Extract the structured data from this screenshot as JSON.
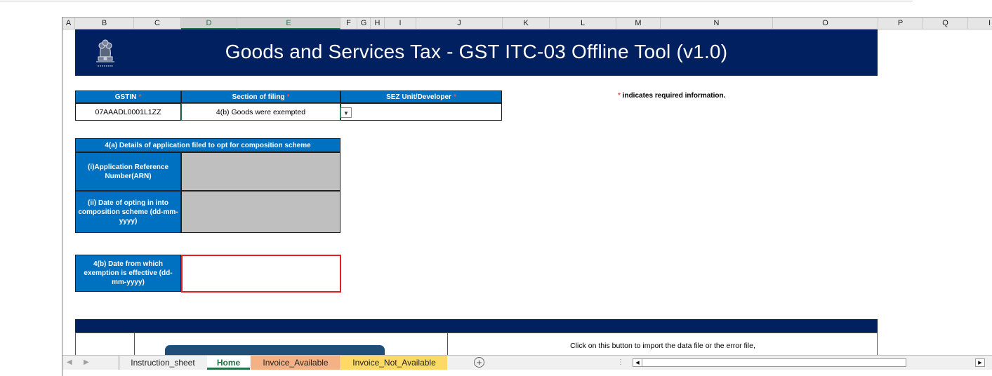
{
  "columns": [
    "A",
    "B",
    "C",
    "D",
    "E",
    "F",
    "G",
    "H",
    "I",
    "J",
    "K",
    "L",
    "M",
    "N",
    "O",
    "P",
    "Q",
    "I"
  ],
  "banner": {
    "title": "Goods and Services Tax - GST ITC-03 Offline Tool (v1.0)",
    "emblem_icon": "ashoka-emblem-icon"
  },
  "form": {
    "gstin_header": "GSTIN",
    "section_header": "Section of filing",
    "sez_header": "SEZ Unit/Developer",
    "gstin_value": "07AAADL0001L1ZZ",
    "section_value": "4(b) Goods were exempted",
    "sez_value": ""
  },
  "required_note": {
    "star": "*",
    "text": " indicates required information."
  },
  "section_4a": {
    "header": "4(a) Details of application filed to opt for composition scheme",
    "arn_label": "(i)Application Reference Number(ARN)",
    "date_label": "(ii) Date of opting in into composition scheme (dd-mm-yyyy)"
  },
  "section_4b": {
    "label": "4(b) Date from which exemption is effective (dd-mm-yyyy)"
  },
  "bottom": {
    "click_note": "Click on this button to import the data file or the error file,"
  },
  "sheet_tabs": [
    "Instruction_sheet",
    "Home",
    "Invoice_Available",
    "Invoice_Not_Available"
  ],
  "colors": {
    "banner": "#002060",
    "header_blue": "#0070c0",
    "active_tab": "#217346",
    "tab_invoice": "#f4b183",
    "tab_not_invoice": "#ffd966",
    "highlight_border": "#e02020"
  }
}
